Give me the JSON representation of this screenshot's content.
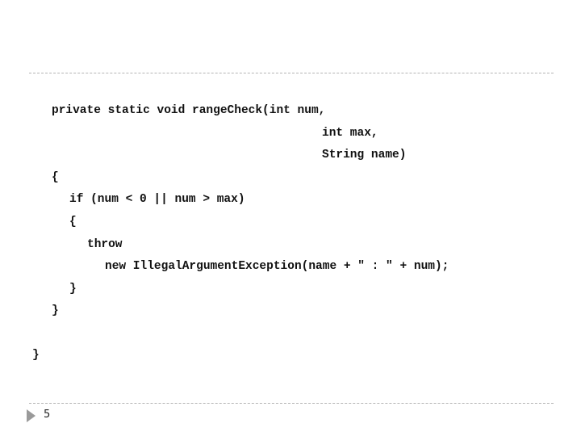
{
  "slide": {
    "code_lines": [
      "private static void rangeCheck(int num,",
      "int max,",
      "String name)",
      "{",
      "if (num < 0 || num > max)",
      "{",
      "throw",
      "new IllegalArgumentException(name + \" : \" + num);",
      "}",
      "}",
      "}"
    ],
    "footer": {
      "bullet_icon": "triangle-right-icon",
      "page_number": "5"
    }
  }
}
